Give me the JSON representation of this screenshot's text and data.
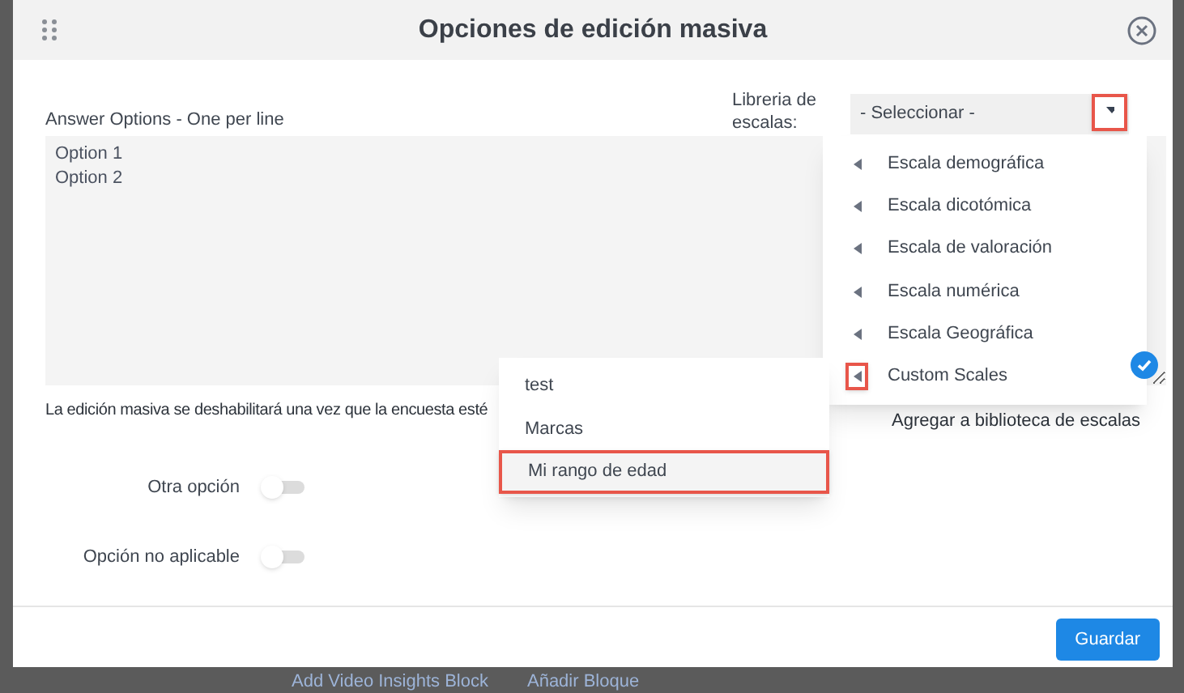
{
  "background_links": [
    "Add Video Insights Block",
    "Añadir Bloque"
  ],
  "dialog": {
    "title": "Opciones de edición masiva"
  },
  "answer_options": {
    "label": "Answer Options - One per line",
    "value": "Option 1\nOption 2"
  },
  "scale_library": {
    "label": "Libreria de escalas:",
    "value": "- Seleccionar -",
    "caret_highlighted": true
  },
  "scale_menu": [
    {
      "label": "Escala demográfica",
      "highlighted": false
    },
    {
      "label": "Escala dicotómica",
      "highlighted": false
    },
    {
      "label": "Escala de valoración",
      "highlighted": false
    },
    {
      "label": "Escala numérica",
      "highlighted": false
    },
    {
      "label": "Escala Geográfica",
      "highlighted": false
    },
    {
      "label": "Custom Scales",
      "highlighted": true
    }
  ],
  "custom_menu": [
    {
      "label": "test",
      "highlighted": false
    },
    {
      "label": "Marcas",
      "highlighted": false
    },
    {
      "label": "Mi rango de edad",
      "highlighted": true
    }
  ],
  "note": "La edición masiva se deshabilitará una vez que la encuesta esté",
  "add_to_library": "Agregar a biblioteca de escalas",
  "toggles": [
    {
      "label": "Otra opción",
      "on": false
    },
    {
      "label": "Opción no aplicable",
      "on": false
    }
  ],
  "save_button": "Guardar"
}
